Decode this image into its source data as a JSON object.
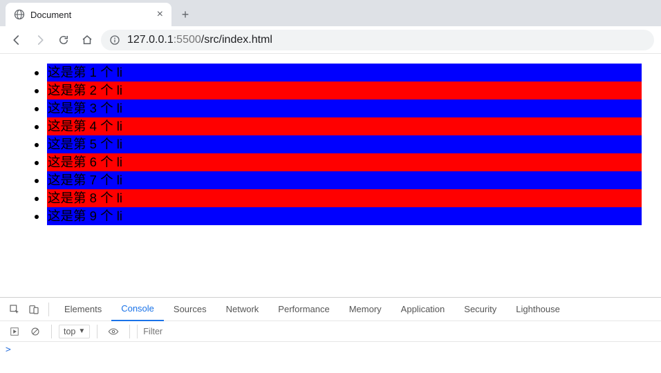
{
  "tab": {
    "title": "Document"
  },
  "url": {
    "host": "127.0.0.1",
    "port": ":5500",
    "path": "/src/index.html"
  },
  "list_items": [
    "这是第 1 个 li",
    "这是第 2 个 li",
    "这是第 3 个 li",
    "这是第 4 个 li",
    "这是第 5 个 li",
    "这是第 6 个 li",
    "这是第 7 个 li",
    "这是第 8 个 li",
    "这是第 9 个 li"
  ],
  "devtools": {
    "tabs": [
      "Elements",
      "Console",
      "Sources",
      "Network",
      "Performance",
      "Memory",
      "Application",
      "Security",
      "Lighthouse"
    ],
    "active_tab": "Console",
    "context_label": "top",
    "filter_placeholder": "Filter"
  }
}
